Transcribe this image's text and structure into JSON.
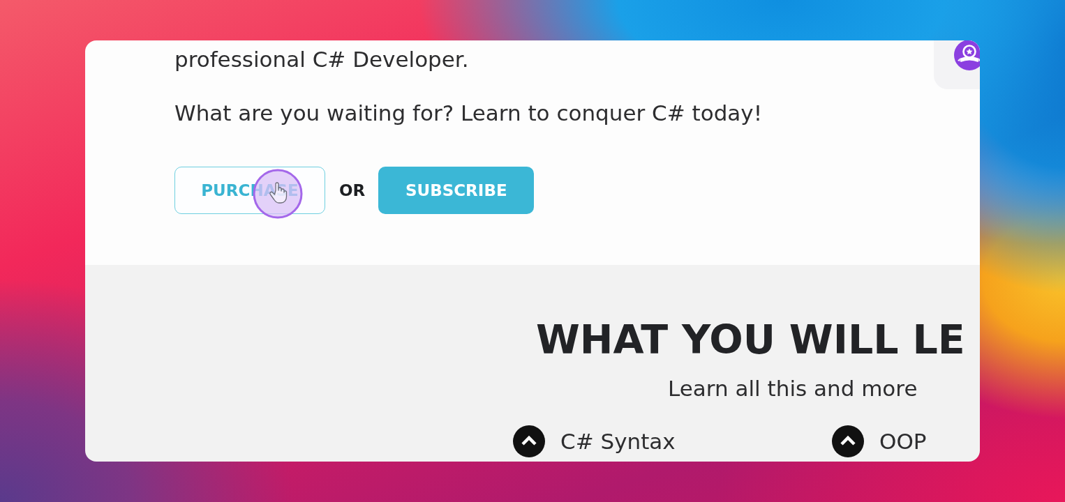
{
  "intro": {
    "paragraphs": [
      "professional C# Developer.",
      "What are you waiting for? Learn to conquer C# today!"
    ]
  },
  "actions": {
    "buttons": [
      {
        "label": "PURCHASE",
        "kind": "outline"
      },
      {
        "label": "SUBSCRIBE",
        "kind": "filled"
      }
    ],
    "separator": "OR"
  },
  "learn": {
    "heading": "WHAT YOU WILL LE",
    "subtitle": "Learn all this and more",
    "topics": [
      "C# Syntax",
      "OOP"
    ]
  }
}
